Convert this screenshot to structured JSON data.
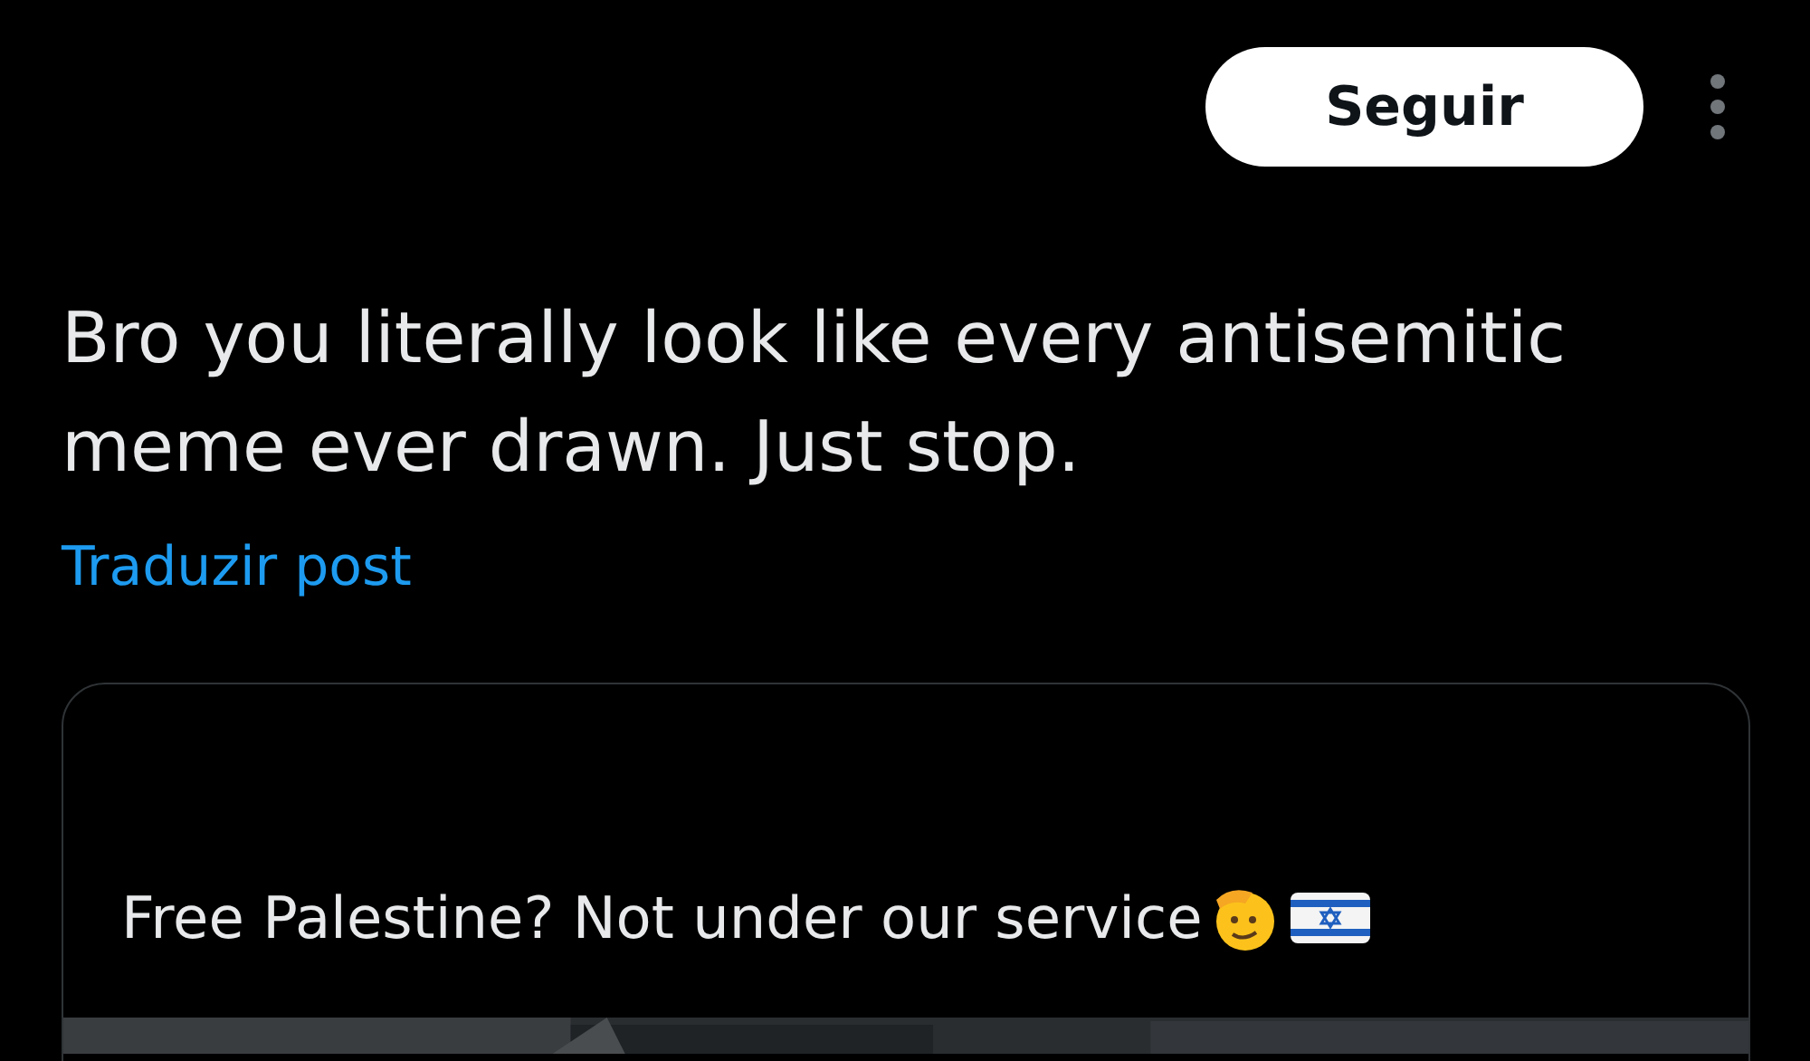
{
  "follow_button": {
    "label": "Seguir"
  },
  "post": {
    "text": "Bro you literally look like every antisemitic meme ever drawn. Just stop.",
    "translate_link": "Traduzir post"
  },
  "quoted_post": {
    "text": "Free Palestine? Not under our service"
  }
}
